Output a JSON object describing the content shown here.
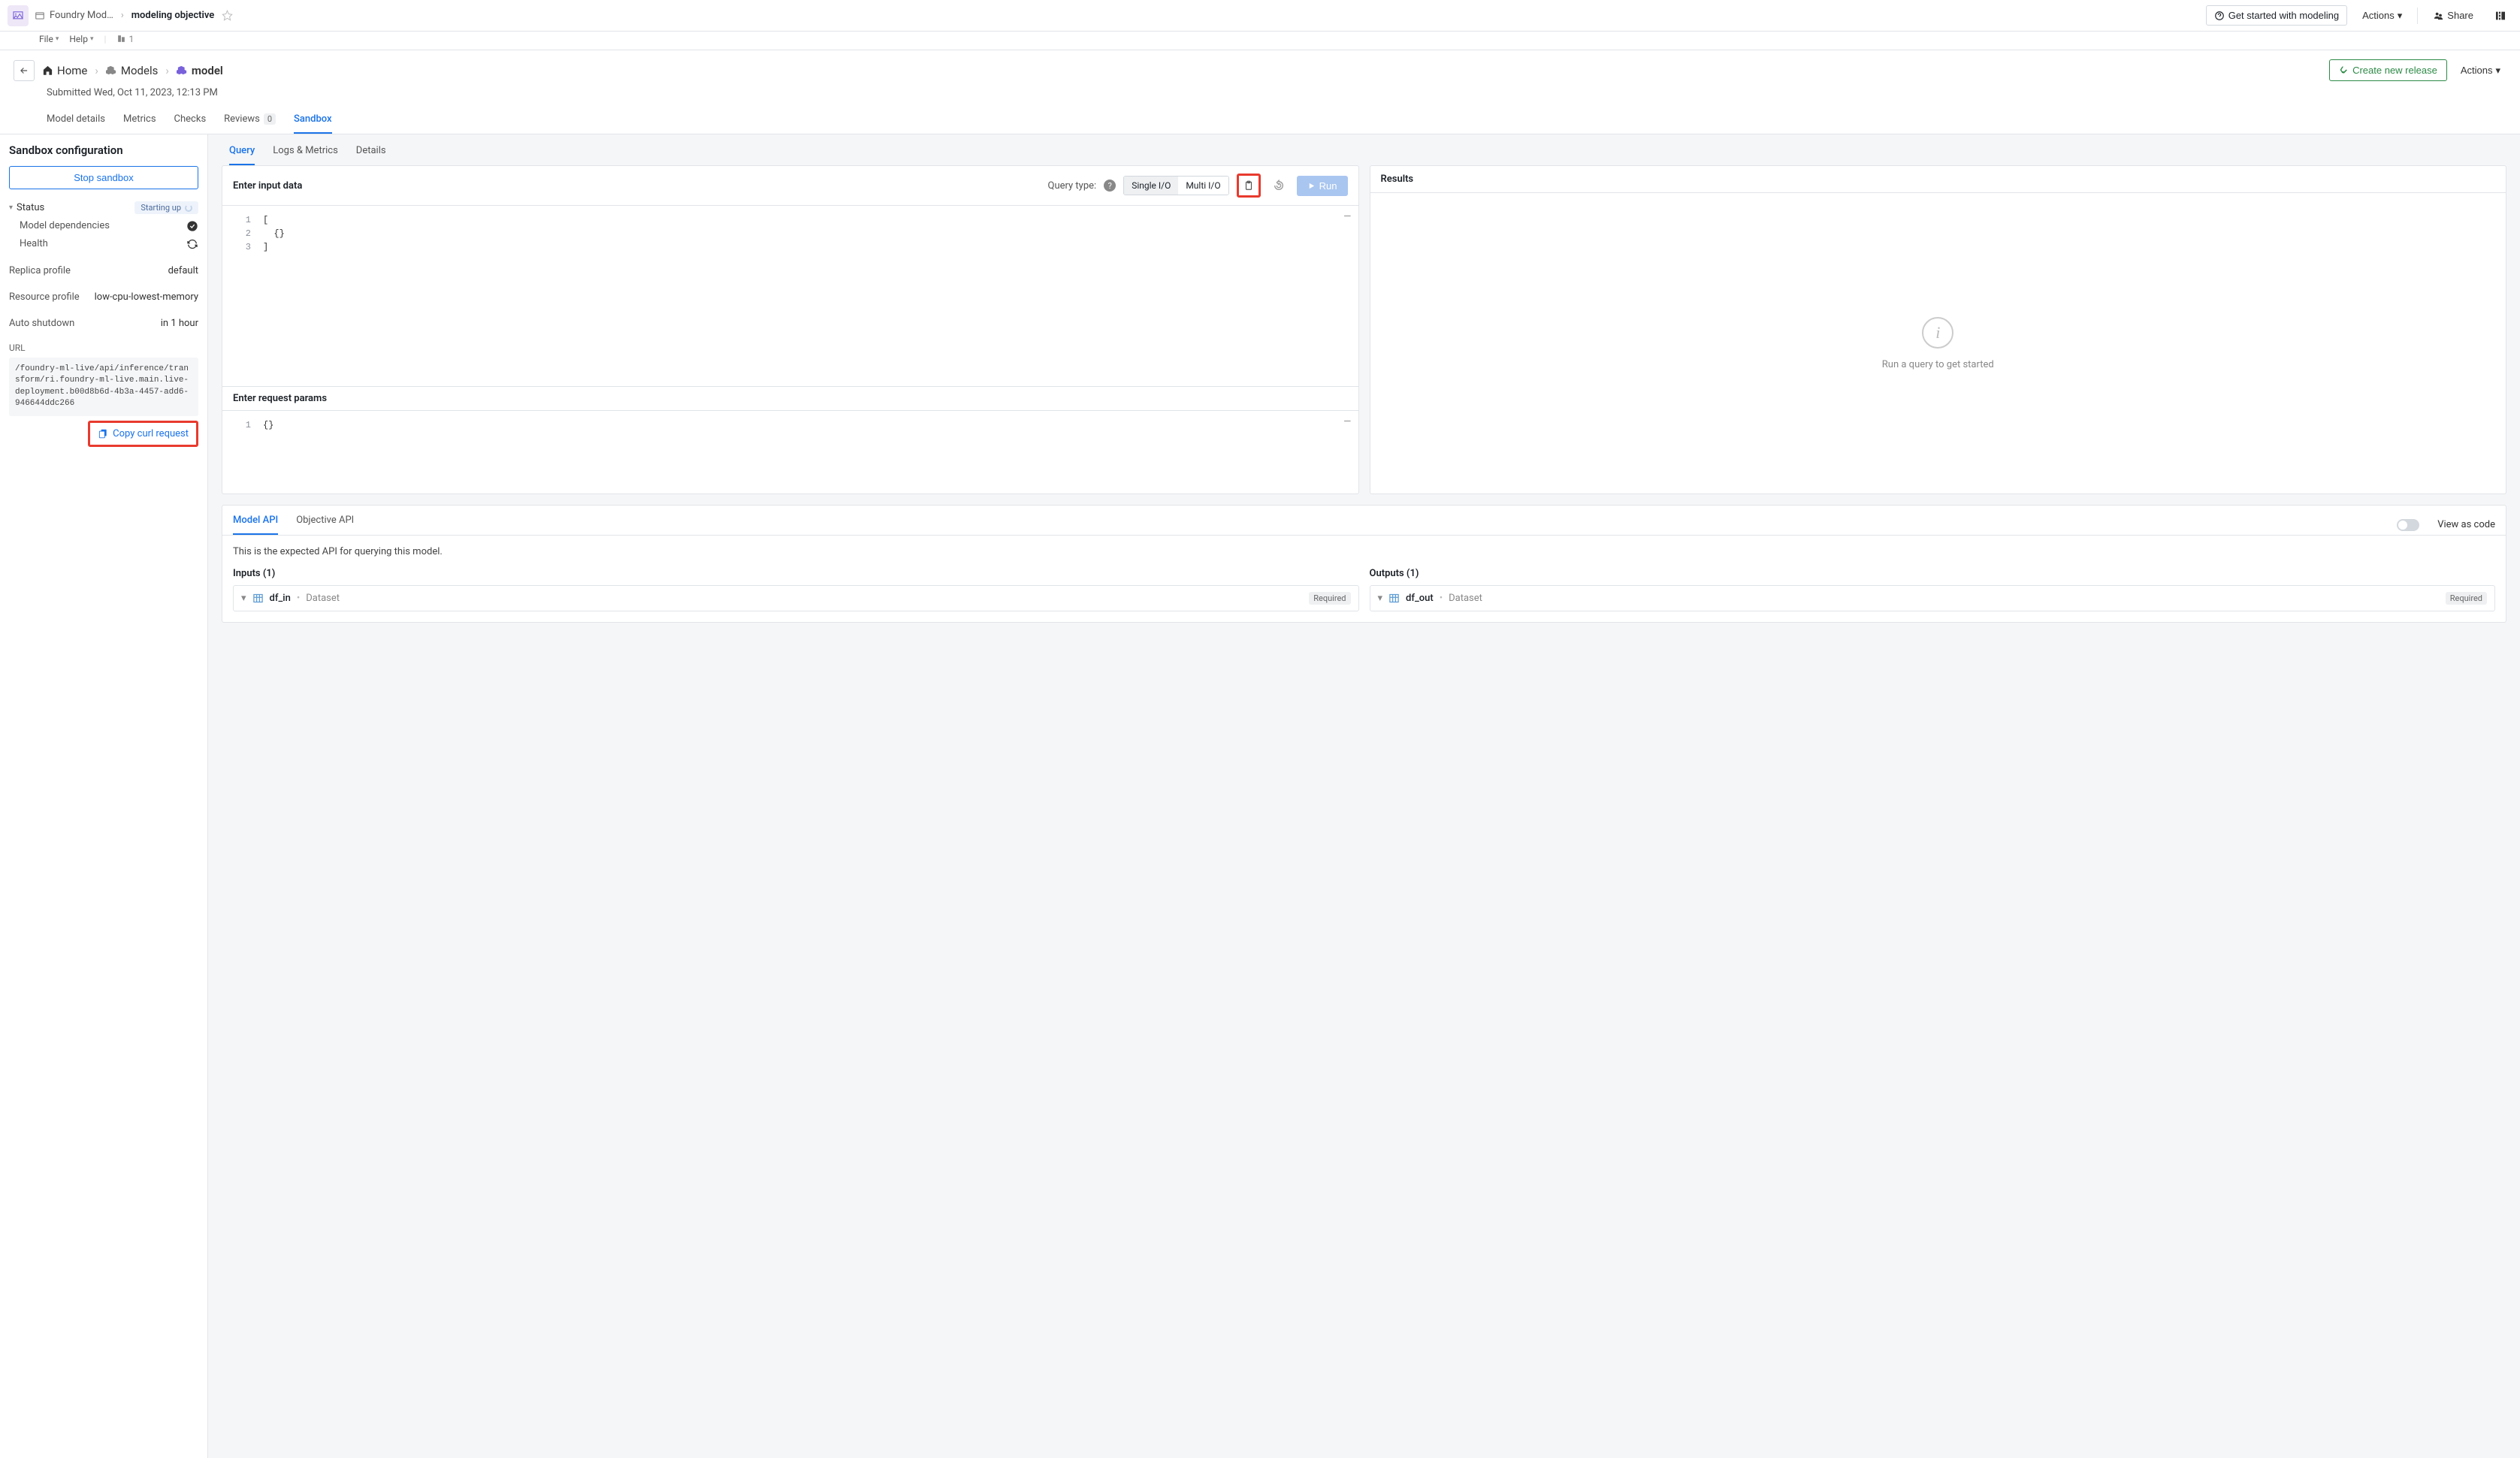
{
  "topbar": {
    "crumb1": "Foundry Mod…",
    "crumb2": "modeling objective",
    "file": "File",
    "help": "Help",
    "org_count": "1",
    "get_started": "Get started with modeling",
    "actions": "Actions",
    "share": "Share"
  },
  "header": {
    "bc": {
      "home": "Home",
      "models": "Models",
      "model": "model"
    },
    "submitted": "Submitted Wed, Oct 11, 2023, 12:13 PM",
    "create_release": "Create new release",
    "actions": "Actions",
    "tabs": {
      "details": "Model details",
      "metrics": "Metrics",
      "checks": "Checks",
      "reviews": "Reviews",
      "reviews_count": "0",
      "sandbox": "Sandbox"
    }
  },
  "sidebar": {
    "title": "Sandbox configuration",
    "stop": "Stop sandbox",
    "status": {
      "label": "Status",
      "chip": "Starting up"
    },
    "deps": {
      "k": "Model dependencies"
    },
    "health": {
      "k": "Health"
    },
    "replica": {
      "k": "Replica profile",
      "v": "default"
    },
    "resource": {
      "k": "Resource profile",
      "v": "low-cpu-lowest-memory"
    },
    "shutdown": {
      "k": "Auto shutdown",
      "v": "in 1 hour"
    },
    "url_label": "URL",
    "url": "/foundry-ml-live/api/inference/transform/ri.foundry-ml-live.main.live-deployment.b00d8b6d-4b3a-4457-add6-946644ddc266",
    "copy_curl": "Copy curl request"
  },
  "main": {
    "tabs": {
      "query": "Query",
      "logs": "Logs & Metrics",
      "details": "Details"
    },
    "input_title": "Enter input data",
    "qtype_label": "Query type:",
    "single": "Single I/O",
    "multi": "Multi I/O",
    "run": "Run",
    "code_lines": [
      "[",
      "  {}",
      "]"
    ],
    "params_title": "Enter request params",
    "param_lines": [
      "{}"
    ],
    "results_title": "Results",
    "results_hint": "Run a query to get started"
  },
  "api": {
    "tab1": "Model API",
    "tab2": "Objective API",
    "view_as_code": "View as code",
    "desc": "This is the expected API for querying this model.",
    "inputs_h": "Inputs (1)",
    "outputs_h": "Outputs (1)",
    "in_name": "df_in",
    "in_type": "Dataset",
    "in_req": "Required",
    "out_name": "df_out",
    "out_type": "Dataset",
    "out_req": "Required"
  }
}
